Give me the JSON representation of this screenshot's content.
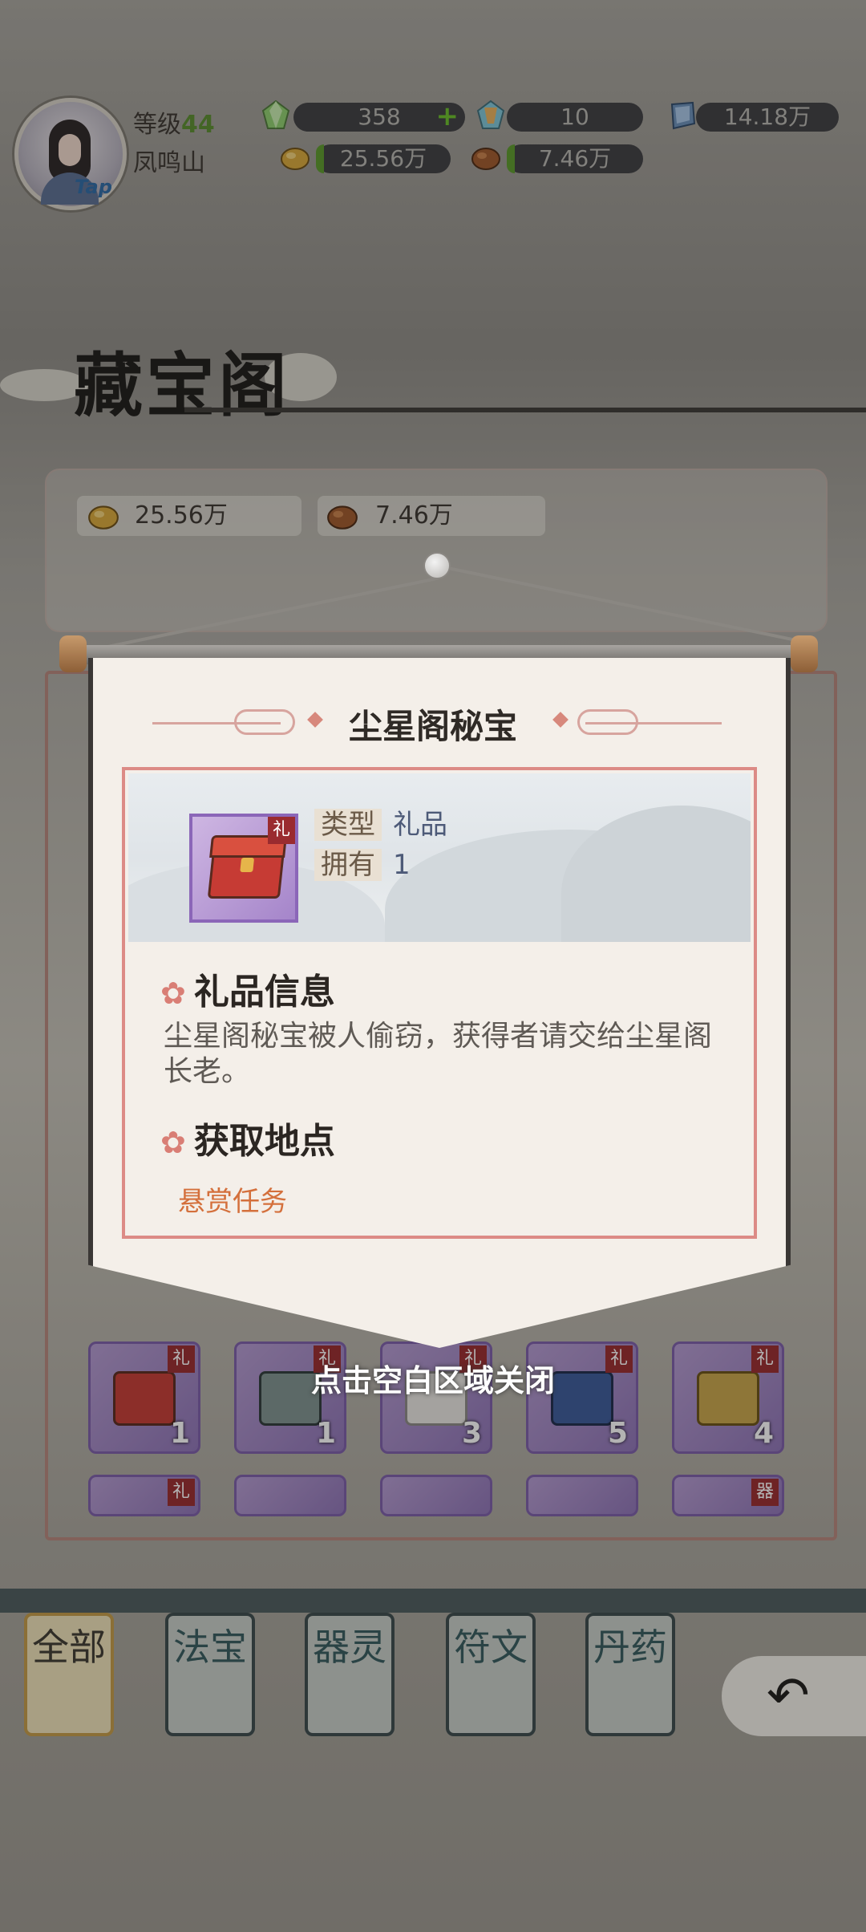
{
  "player": {
    "level_label": "等级",
    "level": "44",
    "location": "凤鸣山",
    "tap_label": "Tap"
  },
  "resources": {
    "green_gem": "358",
    "rainbow_gem": "10",
    "blue_gem": "14.18万",
    "gold_ore": "25.56万",
    "copper_ore": "7.46万"
  },
  "page": {
    "title": "藏宝阁",
    "currency_gold": "25.56万",
    "currency_copper": "7.46万"
  },
  "popup": {
    "title": "尘星阁秘宝",
    "item_tag": "礼",
    "type_key": "类型",
    "type_value": "礼品",
    "own_key": "拥有",
    "own_value": "1",
    "info_heading": "礼品信息",
    "info_text": "尘星阁秘宝被人偷窃，获得者请交给尘星阁长老。",
    "source_heading": "获取地点",
    "source_item": "悬赏任务",
    "close_hint": "点击空白区域关闭"
  },
  "inventory": {
    "tag": "礼",
    "counts": [
      "1",
      "1",
      "3",
      "5",
      "4"
    ],
    "partial_tag_last": "器"
  },
  "tabs": [
    {
      "label": "全部"
    },
    {
      "label": "法宝"
    },
    {
      "label": "器灵"
    },
    {
      "label": "符文"
    },
    {
      "label": "丹药"
    }
  ],
  "colors": {
    "accent_red": "#dc8b86",
    "source_orange": "#d4703c",
    "level_green": "#5a8c2f",
    "gift_tag": "#9a2b2f"
  },
  "icons": {
    "back": "back-arrow-icon",
    "flower": "flower-icon"
  }
}
